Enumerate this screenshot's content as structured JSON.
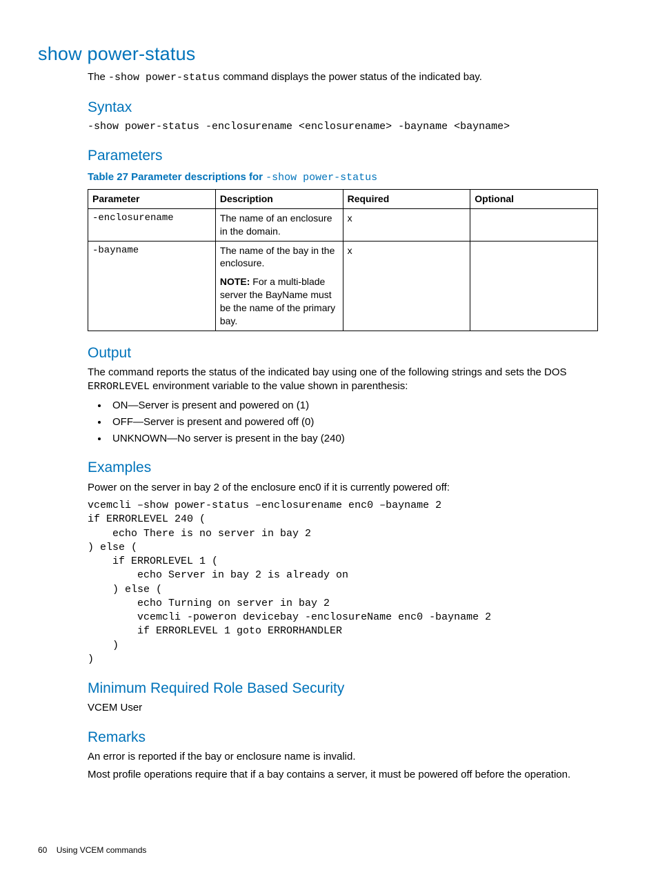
{
  "title": "show power-status",
  "intro_pre": "The ",
  "intro_code": "-show power-status",
  "intro_post": " command displays the power status of the indicated bay.",
  "syntax": {
    "heading": "Syntax",
    "code": "-show power-status -enclosurename <enclosurename> -bayname <bayname>"
  },
  "parameters": {
    "heading": "Parameters",
    "caption_prefix": "Table 27 Parameter descriptions for ",
    "caption_code": "-show power-status",
    "headers": {
      "parameter": "Parameter",
      "description": "Description",
      "required": "Required",
      "optional": "Optional"
    },
    "rows": [
      {
        "parameter": "-enclosurename",
        "description": "The name of an enclosure in the domain.",
        "required": "x",
        "optional": ""
      },
      {
        "parameter": "-bayname",
        "description": "The name of the bay in the enclosure.",
        "note_label": "NOTE:",
        "note_text": "   For a multi-blade server the BayName must be the name of the primary bay.",
        "required": "x",
        "optional": ""
      }
    ]
  },
  "output": {
    "heading": "Output",
    "p_pre": "The command reports the status of the indicated bay using one of the following strings and sets the DOS ",
    "p_code": "ERRORLEVEL",
    "p_post": " environment variable to the value shown in parenthesis:",
    "items": [
      "ON—Server is present and powered on (1)",
      "OFF—Server is present and powered off (0)",
      "UNKNOWN—No server is present in the bay (240)"
    ]
  },
  "examples": {
    "heading": "Examples",
    "lead": "Power on the server in bay 2 of the enclosure enc0 if it is currently powered off:",
    "code": "vcemcli –show power-status –enclosurename enc0 –bayname 2\nif ERRORLEVEL 240 (\n    echo There is no server in bay 2\n) else (\n    if ERRORLEVEL 1 (\n        echo Server in bay 2 is already on\n    ) else (\n        echo Turning on server in bay 2\n        vcemcli -poweron devicebay -enclosureName enc0 -bayname 2\n        if ERRORLEVEL 1 goto ERRORHANDLER\n    )\n)"
  },
  "security": {
    "heading": "Minimum Required Role Based Security",
    "text": "VCEM User"
  },
  "remarks": {
    "heading": "Remarks",
    "p1": "An error is reported if the bay or enclosure name is invalid.",
    "p2": "Most profile operations require that if a bay contains a server, it must be powered off before the operation."
  },
  "footer": {
    "page": "60",
    "section": "Using VCEM commands"
  }
}
